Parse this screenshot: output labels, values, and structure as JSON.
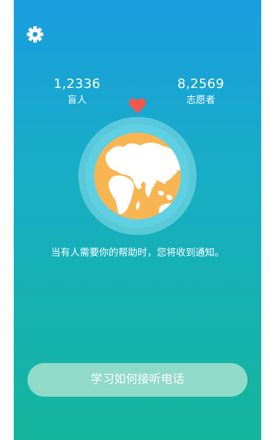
{
  "header": {
    "settings_icon": "gear-icon"
  },
  "stats": {
    "blind": {
      "value": "1,2336",
      "label": "盲人"
    },
    "volunteers": {
      "value": "8,2569",
      "label": "志愿者"
    }
  },
  "decor": {
    "heart_icon": "heart-icon",
    "globe_icon": "globe-icon"
  },
  "main": {
    "message": "当有人需要你的帮助时，您将收到通知。"
  },
  "footer": {
    "learn_button_label": "学习如何接听电话"
  },
  "colors": {
    "gradient_top": "#1a9ee0",
    "gradient_bottom": "#14b59c",
    "globe_ocean": "#f8b552",
    "heart": "#f0584d",
    "button_bg": "#8fdac9"
  }
}
